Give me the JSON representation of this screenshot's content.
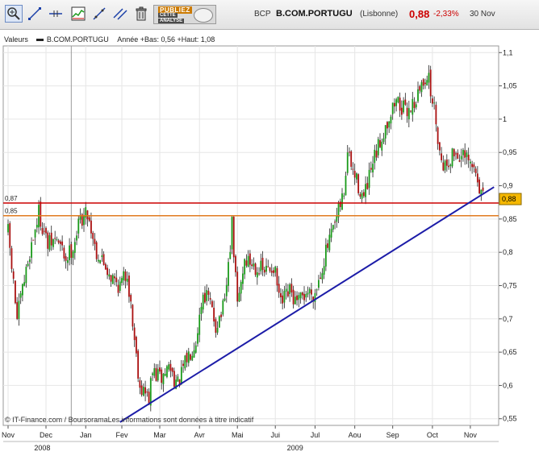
{
  "toolbar": {
    "tools": [
      {
        "icon": "zoom-icon"
      },
      {
        "icon": "line-draw-icon"
      },
      {
        "icon": "horizontal-line-icon"
      },
      {
        "icon": "indicator-chart-icon"
      },
      {
        "icon": "trend-line-icon"
      },
      {
        "icon": "parallel-lines-icon"
      },
      {
        "icon": "trash-icon"
      }
    ],
    "promo": {
      "line1": "PUBLIEZ",
      "line2": "CETTE",
      "line3": "ANALYSE"
    }
  },
  "quote": {
    "ticker": "BCP",
    "name": "B.COM.PORTUGU",
    "exchange": "(Lisbonne)",
    "price": "0,88",
    "change": "-2,33%",
    "date": "30 Nov",
    "change_color": "#cc0000"
  },
  "legend": {
    "label": "Valeurs",
    "series": "B.COM.PORTUGU",
    "range_text": "Année +Bas: 0,56 +Haut: 1,08"
  },
  "footer_note": "© IT-Finance.com / BoursoramaLes informations sont données à titre indicatif",
  "chart_data": {
    "type": "candlestick",
    "series_name": "B.COM.PORTUGU",
    "ylim": [
      0.54,
      1.11
    ],
    "y_ticks": [
      "1,1",
      "1,05",
      "1",
      "0,95",
      "0,9",
      "0,85",
      "0,8",
      "0,75",
      "0,7",
      "0,65",
      "0,6",
      "0,55"
    ],
    "y_tick_values": [
      1.1,
      1.05,
      1.0,
      0.95,
      0.9,
      0.85,
      0.8,
      0.75,
      0.7,
      0.65,
      0.6,
      0.55
    ],
    "x_ticks": [
      "Nov",
      "Dec",
      "Jan",
      "Fev",
      "Mar",
      "Avr",
      "Mai",
      "Jui",
      "Jul",
      "Aou",
      "Sep",
      "Oct",
      "Nov"
    ],
    "x_tick_index": [
      0,
      21,
      43,
      63,
      84,
      106,
      127,
      148,
      170,
      192,
      213,
      235,
      256
    ],
    "years": [
      {
        "label": "2008",
        "at_index": 10
      },
      {
        "label": "2009",
        "at_index": 150
      }
    ],
    "n_bars": 270,
    "close_path": [
      [
        0,
        0.83
      ],
      [
        5,
        0.7
      ],
      [
        12,
        0.8
      ],
      [
        17,
        0.86
      ],
      [
        22,
        0.81
      ],
      [
        27,
        0.82
      ],
      [
        32,
        0.79
      ],
      [
        36,
        0.81
      ],
      [
        40,
        0.85
      ],
      [
        44,
        0.86
      ],
      [
        49,
        0.8
      ],
      [
        54,
        0.78
      ],
      [
        58,
        0.76
      ],
      [
        62,
        0.75
      ],
      [
        66,
        0.77
      ],
      [
        70,
        0.67
      ],
      [
        73,
        0.6
      ],
      [
        78,
        0.58
      ],
      [
        80,
        0.62
      ],
      [
        85,
        0.61
      ],
      [
        89,
        0.63
      ],
      [
        94,
        0.6
      ],
      [
        99,
        0.64
      ],
      [
        104,
        0.67
      ],
      [
        108,
        0.74
      ],
      [
        111,
        0.73
      ],
      [
        115,
        0.69
      ],
      [
        120,
        0.72
      ],
      [
        124,
        0.84
      ],
      [
        127,
        0.72
      ],
      [
        131,
        0.79
      ],
      [
        137,
        0.78
      ],
      [
        142,
        0.77
      ],
      [
        147,
        0.78
      ],
      [
        151,
        0.72
      ],
      [
        156,
        0.74
      ],
      [
        160,
        0.72
      ],
      [
        165,
        0.74
      ],
      [
        170,
        0.74
      ],
      [
        176,
        0.8
      ],
      [
        181,
        0.84
      ],
      [
        186,
        0.89
      ],
      [
        188,
        0.95
      ],
      [
        191,
        0.92
      ],
      [
        197,
        0.88
      ],
      [
        203,
        0.94
      ],
      [
        209,
        0.99
      ],
      [
        215,
        1.03
      ],
      [
        220,
        1.01
      ],
      [
        226,
        1.03
      ],
      [
        232,
        1.07
      ],
      [
        237,
        1.0
      ],
      [
        239,
        0.95
      ],
      [
        242,
        0.93
      ],
      [
        247,
        0.95
      ],
      [
        253,
        0.94
      ],
      [
        259,
        0.92
      ],
      [
        263,
        0.88
      ]
    ],
    "price_marker": "0,88",
    "horizontal_lines": [
      {
        "label": "0,87",
        "value": 0.874,
        "color": "#cc0000"
      },
      {
        "label": "0,85",
        "value": 0.855,
        "color": "#e07a1e"
      }
    ],
    "trend_line": {
      "color": "#1c1ca8",
      "points": [
        {
          "index": 62,
          "value": 0.545
        },
        {
          "index": 270,
          "value": 0.898
        }
      ]
    },
    "vertical_marker_index": 35,
    "colors": {
      "up": "#1a9a1a",
      "down": "#aa1010",
      "grid": "#e6e6e6",
      "frame": "#9a9a9a",
      "price_marker": "#f5b800"
    }
  }
}
